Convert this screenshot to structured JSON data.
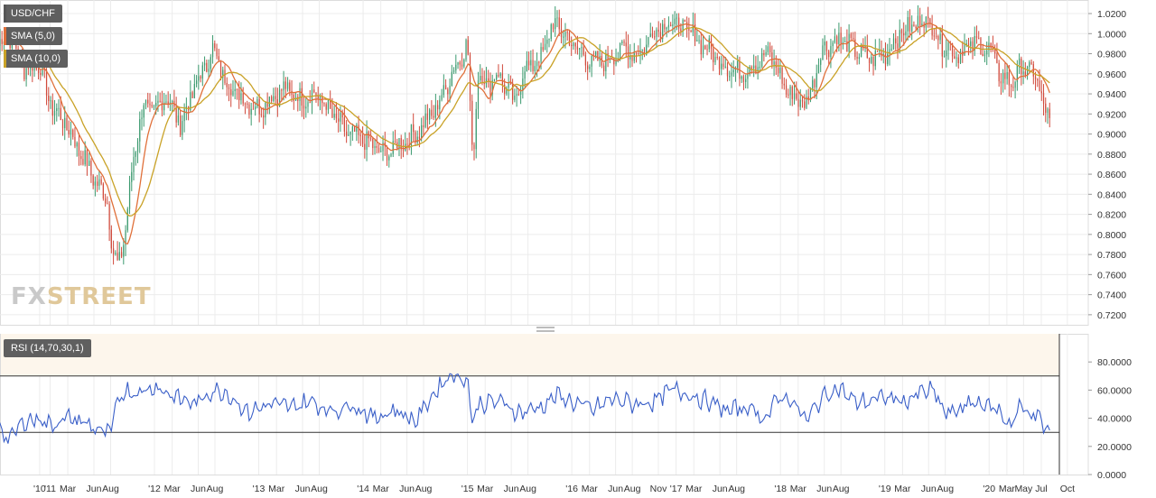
{
  "chart_data": [
    {
      "type": "candlestick",
      "pane": "price",
      "instrument": "USD/CHF",
      "timeframe_labels": [
        "'10",
        "'11",
        "Mar",
        "Jun",
        "Aug",
        "'12",
        "Mar",
        "Jun",
        "Aug",
        "'13",
        "Mar",
        "Jun",
        "Aug",
        "'14",
        "Mar",
        "Jun",
        "Aug",
        "'15",
        "Mar",
        "Jun",
        "Aug",
        "'16",
        "Mar",
        "Jun",
        "Aug",
        "Nov",
        "'17",
        "Mar",
        "Jun",
        "Aug",
        "'18",
        "Mar",
        "Jun",
        "Aug",
        "'19",
        "Mar",
        "Jun",
        "Aug",
        "'20",
        "Mar",
        "May",
        "Jul",
        "Oct"
      ],
      "x_label_dates": [
        2010.9,
        2011.0,
        2011.17,
        2011.42,
        2011.58,
        2012.0,
        2012.17,
        2012.42,
        2012.58,
        2013.0,
        2013.17,
        2013.42,
        2013.58,
        2014.0,
        2014.17,
        2014.42,
        2014.58,
        2015.0,
        2015.17,
        2015.42,
        2015.58,
        2016.0,
        2016.17,
        2016.42,
        2016.58,
        2016.83,
        2017.0,
        2017.17,
        2017.42,
        2017.58,
        2018.0,
        2018.17,
        2018.42,
        2018.58,
        2019.0,
        2019.17,
        2019.42,
        2019.58,
        2020.0,
        2020.17,
        2020.33,
        2020.5,
        2020.75
      ],
      "y_ticks": [
        "1.0200",
        "1.0000",
        "0.9800",
        "0.9600",
        "0.9400",
        "0.9200",
        "0.9000",
        "0.8800",
        "0.8600",
        "0.8400",
        "0.8200",
        "0.8000",
        "0.7800",
        "0.7600",
        "0.7400",
        "0.7200"
      ],
      "y_tick_values": [
        1.02,
        1.0,
        0.98,
        0.96,
        0.94,
        0.92,
        0.9,
        0.88,
        0.86,
        0.84,
        0.82,
        0.8,
        0.78,
        0.76,
        0.74,
        0.72
      ],
      "ylim": [
        0.71,
        1.0335
      ],
      "series": [
        {
          "name": "SMA (5,0)",
          "color": "#e0703a"
        },
        {
          "name": "SMA (10,0)",
          "color": "#c9a227"
        }
      ],
      "close_anchors": {
        "x": [
          2010.5,
          2010.6,
          2010.75,
          2010.9,
          2011.0,
          2011.15,
          2011.3,
          2011.45,
          2011.55,
          2011.6,
          2011.65,
          2011.72,
          2011.8,
          2011.9,
          2012.0,
          2012.1,
          2012.25,
          2012.4,
          2012.5,
          2012.55,
          2012.7,
          2012.85,
          2013.0,
          2013.1,
          2013.25,
          2013.4,
          2013.55,
          2013.7,
          2013.85,
          2014.0,
          2014.2,
          2014.35,
          2014.5,
          2014.7,
          2014.85,
          2014.95,
          2015.0,
          2015.05,
          2015.1,
          2015.2,
          2015.3,
          2015.45,
          2015.55,
          2015.7,
          2015.8,
          2015.85,
          2016.0,
          2016.1,
          2016.2,
          2016.35,
          2016.5,
          2016.65,
          2016.8,
          2016.92,
          2017.0,
          2017.15,
          2017.3,
          2017.45,
          2017.6,
          2017.75,
          2017.9,
          2018.05,
          2018.15,
          2018.25,
          2018.4,
          2018.55,
          2018.7,
          2018.85,
          2019.0,
          2019.15,
          2019.3,
          2019.4,
          2019.55,
          2019.7,
          2019.85,
          2020.0,
          2020.1,
          2020.2,
          2020.3,
          2020.4,
          2020.5,
          2020.58
        ],
        "y": [
          0.988,
          1.0,
          0.965,
          0.97,
          0.93,
          0.91,
          0.88,
          0.85,
          0.835,
          0.78,
          0.77,
          0.8,
          0.88,
          0.93,
          0.92,
          0.94,
          0.91,
          0.95,
          0.97,
          0.985,
          0.95,
          0.935,
          0.925,
          0.935,
          0.945,
          0.935,
          0.94,
          0.92,
          0.9,
          0.895,
          0.88,
          0.89,
          0.9,
          0.925,
          0.96,
          0.98,
          0.99,
          0.87,
          0.96,
          0.95,
          0.96,
          0.93,
          0.965,
          0.975,
          1.005,
          1.01,
          0.99,
          0.98,
          0.97,
          0.975,
          0.985,
          0.98,
          1.005,
          1.01,
          1.01,
          1.0,
          0.985,
          0.97,
          0.96,
          0.97,
          0.98,
          0.945,
          0.935,
          0.93,
          0.985,
          0.995,
          0.985,
          0.975,
          0.98,
          1.0,
          1.01,
          1.015,
          0.99,
          0.98,
          0.99,
          0.985,
          0.96,
          0.95,
          0.965,
          0.965,
          0.94,
          0.908
        ]
      }
    },
    {
      "type": "line",
      "pane": "oscillator",
      "indicator": "RSI (14,70,30,1)",
      "series": [
        {
          "name": "RSI (14,70,30,1)",
          "color": "#3a5fc8"
        }
      ],
      "overbought": 70,
      "oversold": 30,
      "y_ticks": [
        "80.0000",
        "60.0000",
        "40.0000",
        "20.0000",
        "0.0000"
      ],
      "y_tick_values": [
        80,
        60,
        40,
        20,
        0
      ],
      "ylim": [
        0,
        100
      ],
      "anchors": {
        "x": [
          2010.5,
          2010.6,
          2010.75,
          2010.9,
          2011.0,
          2011.15,
          2011.3,
          2011.45,
          2011.58,
          2011.62,
          2011.7,
          2011.85,
          2012.0,
          2012.2,
          2012.4,
          2012.55,
          2012.7,
          2012.9,
          2013.1,
          2013.3,
          2013.5,
          2013.7,
          2013.9,
          2014.1,
          2014.3,
          2014.5,
          2014.7,
          2014.85,
          2014.95,
          2015.0,
          2015.04,
          2015.1,
          2015.3,
          2015.5,
          2015.7,
          2015.85,
          2016.0,
          2016.2,
          2016.4,
          2016.6,
          2016.8,
          2016.95,
          2017.1,
          2017.3,
          2017.5,
          2017.7,
          2017.85,
          2018.0,
          2018.1,
          2018.25,
          2018.4,
          2018.55,
          2018.7,
          2018.85,
          2019.0,
          2019.2,
          2019.35,
          2019.45,
          2019.6,
          2019.75,
          2019.9,
          2020.0,
          2020.1,
          2020.15,
          2020.2,
          2020.3,
          2020.4,
          2020.5,
          2020.58
        ],
        "y": [
          38,
          24,
          38,
          40,
          35,
          40,
          38,
          32,
          28,
          45,
          60,
          58,
          63,
          55,
          50,
          60,
          58,
          44,
          50,
          48,
          52,
          45,
          50,
          40,
          46,
          38,
          60,
          72,
          67,
          72,
          35,
          50,
          52,
          44,
          48,
          56,
          52,
          46,
          54,
          50,
          52,
          60,
          58,
          52,
          45,
          48,
          40,
          55,
          54,
          38,
          55,
          62,
          52,
          52,
          55,
          52,
          58,
          60,
          42,
          48,
          52,
          48,
          45,
          40,
          35,
          48,
          44,
          38,
          28
        ]
      }
    }
  ],
  "legend": [
    {
      "label": "USD/CHF",
      "swatch": "#555555"
    },
    {
      "label": "SMA (5,0)",
      "swatch": "#e0703a"
    },
    {
      "label": "SMA (10,0)",
      "swatch": "#c9a227"
    }
  ],
  "indicator_legend": {
    "label": "RSI (14,70,30,1)"
  },
  "watermark": {
    "prefix": "FX",
    "word": "STREET"
  },
  "colors": {
    "bull": "#3c9a6f",
    "bear": "#d14a3c",
    "grid": "#ececec",
    "rsi_band": "#fdf6ec"
  }
}
